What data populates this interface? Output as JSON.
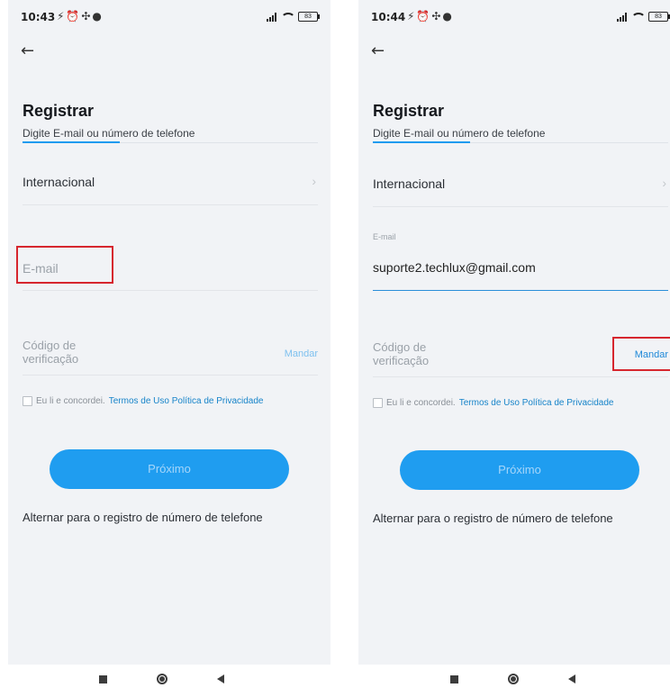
{
  "left": {
    "status": {
      "time": "10:43",
      "icons": "⚡⏰✣●",
      "battery": "83"
    },
    "title": "Registrar",
    "subtitle": "Digite E-mail ou número de telefone",
    "region_label": "Internacional",
    "email": {
      "value": "",
      "placeholder": "E-mail"
    },
    "code_label": "Código de\nverificação",
    "send_label": "Mandar",
    "agree_text": "Eu li e concordei.",
    "terms_text": "Termos de Uso Política de Privacidade",
    "next_label": "Próximo",
    "switch_label": "Alternar para o registro de número de telefone"
  },
  "right": {
    "status": {
      "time": "10:44",
      "icons": "⚡⏰✣●",
      "battery": "83"
    },
    "title": "Registrar",
    "subtitle": "Digite E-mail ou número de telefone",
    "region_label": "Internacional",
    "email": {
      "label": "E-mail",
      "value": "suporte2.techlux@gmail.com"
    },
    "code_label": "Código de\nverificação",
    "send_label": "Mandar",
    "agree_text": "Eu li e concordei.",
    "terms_text": "Termos de Uso Política de Privacidade",
    "next_label": "Próximo",
    "switch_label": "Alternar para o registro de número de telefone"
  },
  "icons": {
    "back": "←",
    "chevron": "›"
  },
  "colors": {
    "accent": "#1f9df0",
    "link": "#1784c9",
    "highlight_box": "#d6262e"
  }
}
